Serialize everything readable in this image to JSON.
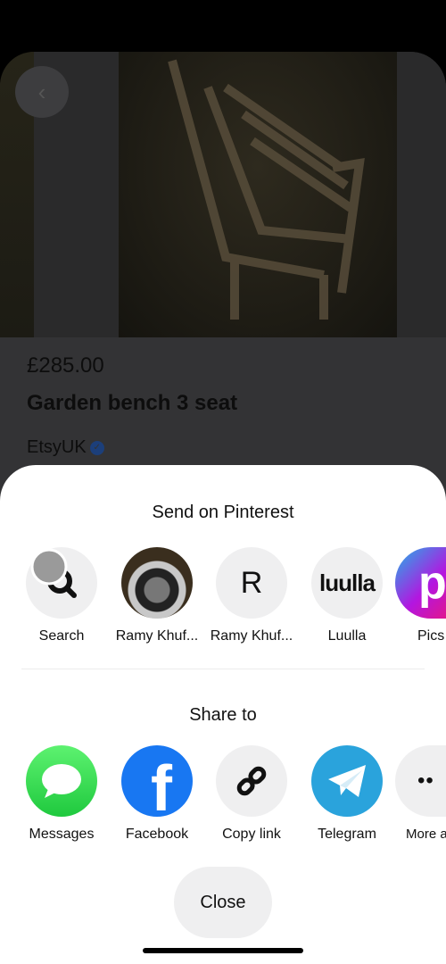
{
  "product": {
    "price": "£285.00",
    "title": "Garden bench 3 seat",
    "seller": "EtsyUK"
  },
  "sheet": {
    "send_title": "Send on Pinterest",
    "contacts": [
      {
        "label": "Search",
        "icon": "search-icon"
      },
      {
        "label": "Ramy Khuf...",
        "icon": "camera-avatar"
      },
      {
        "label": "Ramy Khuf...",
        "initial": "R"
      },
      {
        "label": "Luulla",
        "logo": "luulla"
      },
      {
        "label": "Pics",
        "icon": "picsart-logo"
      }
    ],
    "share_title": "Share to",
    "apps": [
      {
        "label": "Messages",
        "color": "#34c759"
      },
      {
        "label": "Facebook",
        "color": "#1877f2"
      },
      {
        "label": "Copy link"
      },
      {
        "label": "Telegram",
        "color": "#2aa3dc"
      },
      {
        "label": "More a"
      }
    ],
    "close_label": "Close"
  }
}
